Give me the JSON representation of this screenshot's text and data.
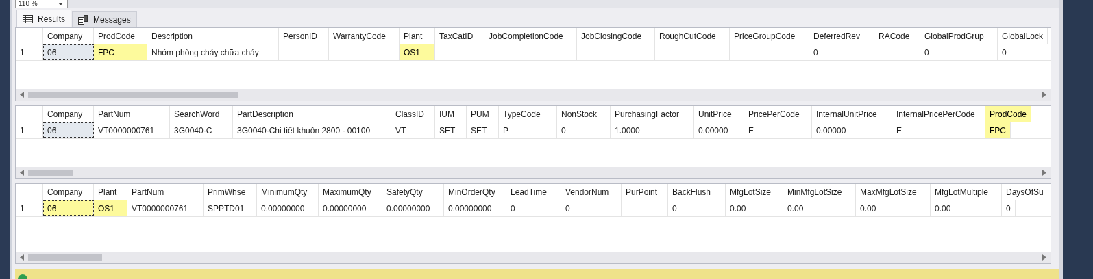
{
  "zoom": {
    "value": "110 %"
  },
  "tabs": [
    {
      "label": "Results",
      "kind": "grid",
      "selected": true
    },
    {
      "label": "Messages",
      "kind": "messages",
      "selected": false
    }
  ],
  "grids": [
    {
      "columns": [
        {
          "name": "Company",
          "highlighted": false
        },
        {
          "name": "ProdCode",
          "highlighted": false
        },
        {
          "name": "Description",
          "highlighted": false
        },
        {
          "name": "PersonID",
          "highlighted": false
        },
        {
          "name": "WarrantyCode",
          "highlighted": false
        },
        {
          "name": "Plant",
          "highlighted": false
        },
        {
          "name": "TaxCatID",
          "highlighted": false
        },
        {
          "name": "JobCompletionCode",
          "highlighted": false
        },
        {
          "name": "JobClosingCode",
          "highlighted": false
        },
        {
          "name": "RoughCutCode",
          "highlighted": false
        },
        {
          "name": "PriceGroupCode",
          "highlighted": false
        },
        {
          "name": "DeferredRev",
          "highlighted": false
        },
        {
          "name": "RACode",
          "highlighted": false
        },
        {
          "name": "GlobalProdGrup",
          "highlighted": false
        },
        {
          "name": "GlobalLock",
          "highlighted": false
        }
      ],
      "rows": [
        {
          "number": "1",
          "cells": [
            {
              "text": "06",
              "selected": true,
              "highlighted": false
            },
            {
              "text": "FPC",
              "selected": false,
              "highlighted": true
            },
            {
              "text": "Nhóm phòng cháy chữa cháy",
              "selected": false,
              "highlighted": false
            },
            {
              "text": "",
              "selected": false,
              "highlighted": false
            },
            {
              "text": "",
              "selected": false,
              "highlighted": false
            },
            {
              "text": "OS1",
              "selected": false,
              "highlighted": true
            },
            {
              "text": "",
              "selected": false,
              "highlighted": false
            },
            {
              "text": "",
              "selected": false,
              "highlighted": false
            },
            {
              "text": "",
              "selected": false,
              "highlighted": false
            },
            {
              "text": "",
              "selected": false,
              "highlighted": false
            },
            {
              "text": "",
              "selected": false,
              "highlighted": false
            },
            {
              "text": "0",
              "selected": false,
              "highlighted": false
            },
            {
              "text": "",
              "selected": false,
              "highlighted": false
            },
            {
              "text": "0",
              "selected": false,
              "highlighted": false
            },
            {
              "text": "0",
              "selected": false,
              "highlighted": false
            }
          ]
        }
      ]
    },
    {
      "columns": [
        {
          "name": "Company",
          "highlighted": false
        },
        {
          "name": "PartNum",
          "highlighted": false
        },
        {
          "name": "SearchWord",
          "highlighted": false
        },
        {
          "name": "PartDescription",
          "highlighted": false
        },
        {
          "name": "ClassID",
          "highlighted": false
        },
        {
          "name": "IUM",
          "highlighted": false
        },
        {
          "name": "PUM",
          "highlighted": false
        },
        {
          "name": "TypeCode",
          "highlighted": false
        },
        {
          "name": "NonStock",
          "highlighted": false
        },
        {
          "name": "PurchasingFactor",
          "highlighted": false
        },
        {
          "name": "UnitPrice",
          "highlighted": false
        },
        {
          "name": "PricePerCode",
          "highlighted": false
        },
        {
          "name": "InternalUnitPrice",
          "highlighted": false
        },
        {
          "name": "InternalPricePerCode",
          "highlighted": false
        },
        {
          "name": "ProdCode",
          "highlighted": true
        }
      ],
      "rows": [
        {
          "number": "1",
          "cells": [
            {
              "text": "06",
              "selected": true,
              "highlighted": false
            },
            {
              "text": "VT0000000761",
              "selected": false,
              "highlighted": false
            },
            {
              "text": "3G0040-C",
              "selected": false,
              "highlighted": false
            },
            {
              "text": "3G0040-Chi tiết khuôn 2800 - 00100",
              "selected": false,
              "highlighted": false
            },
            {
              "text": "VT",
              "selected": false,
              "highlighted": false
            },
            {
              "text": "SET",
              "selected": false,
              "highlighted": false
            },
            {
              "text": "SET",
              "selected": false,
              "highlighted": false
            },
            {
              "text": "P",
              "selected": false,
              "highlighted": false
            },
            {
              "text": "0",
              "selected": false,
              "highlighted": false
            },
            {
              "text": "1.0000",
              "selected": false,
              "highlighted": false
            },
            {
              "text": "0.00000",
              "selected": false,
              "highlighted": false
            },
            {
              "text": "E",
              "selected": false,
              "highlighted": false
            },
            {
              "text": "0.00000",
              "selected": false,
              "highlighted": false
            },
            {
              "text": "E",
              "selected": false,
              "highlighted": false
            },
            {
              "text": "FPC",
              "selected": false,
              "highlighted": true
            }
          ]
        }
      ]
    },
    {
      "columns": [
        {
          "name": "Company",
          "highlighted": false
        },
        {
          "name": "Plant",
          "highlighted": false
        },
        {
          "name": "PartNum",
          "highlighted": false
        },
        {
          "name": "PrimWhse",
          "highlighted": false
        },
        {
          "name": "MinimumQty",
          "highlighted": false
        },
        {
          "name": "MaximumQty",
          "highlighted": false
        },
        {
          "name": "SafetyQty",
          "highlighted": false
        },
        {
          "name": "MinOrderQty",
          "highlighted": false
        },
        {
          "name": "LeadTime",
          "highlighted": false
        },
        {
          "name": "VendorNum",
          "highlighted": false
        },
        {
          "name": "PurPoint",
          "highlighted": false
        },
        {
          "name": "BackFlush",
          "highlighted": false
        },
        {
          "name": "MfgLotSize",
          "highlighted": false
        },
        {
          "name": "MinMfgLotSize",
          "highlighted": false
        },
        {
          "name": "MaxMfgLotSize",
          "highlighted": false
        },
        {
          "name": "MfgLotMultiple",
          "highlighted": false
        },
        {
          "name": "DaysOfSu",
          "highlighted": false
        }
      ],
      "rows": [
        {
          "number": "1",
          "cells": [
            {
              "text": "06",
              "selected": true,
              "highlighted": true
            },
            {
              "text": "OS1",
              "selected": false,
              "highlighted": true
            },
            {
              "text": "VT0000000761",
              "selected": false,
              "highlighted": false
            },
            {
              "text": "SPPTD01",
              "selected": false,
              "highlighted": false
            },
            {
              "text": "0.00000000",
              "selected": false,
              "highlighted": false
            },
            {
              "text": "0.00000000",
              "selected": false,
              "highlighted": false
            },
            {
              "text": "0.00000000",
              "selected": false,
              "highlighted": false
            },
            {
              "text": "0.00000000",
              "selected": false,
              "highlighted": false
            },
            {
              "text": "0",
              "selected": false,
              "highlighted": false
            },
            {
              "text": "0",
              "selected": false,
              "highlighted": false
            },
            {
              "text": "",
              "selected": false,
              "highlighted": false
            },
            {
              "text": "0",
              "selected": false,
              "highlighted": false
            },
            {
              "text": "0.00",
              "selected": false,
              "highlighted": false
            },
            {
              "text": "0.00",
              "selected": false,
              "highlighted": false
            },
            {
              "text": "0.00",
              "selected": false,
              "highlighted": false
            },
            {
              "text": "0.00",
              "selected": false,
              "highlighted": false
            },
            {
              "text": "0",
              "selected": false,
              "highlighted": false
            }
          ]
        }
      ]
    }
  ]
}
